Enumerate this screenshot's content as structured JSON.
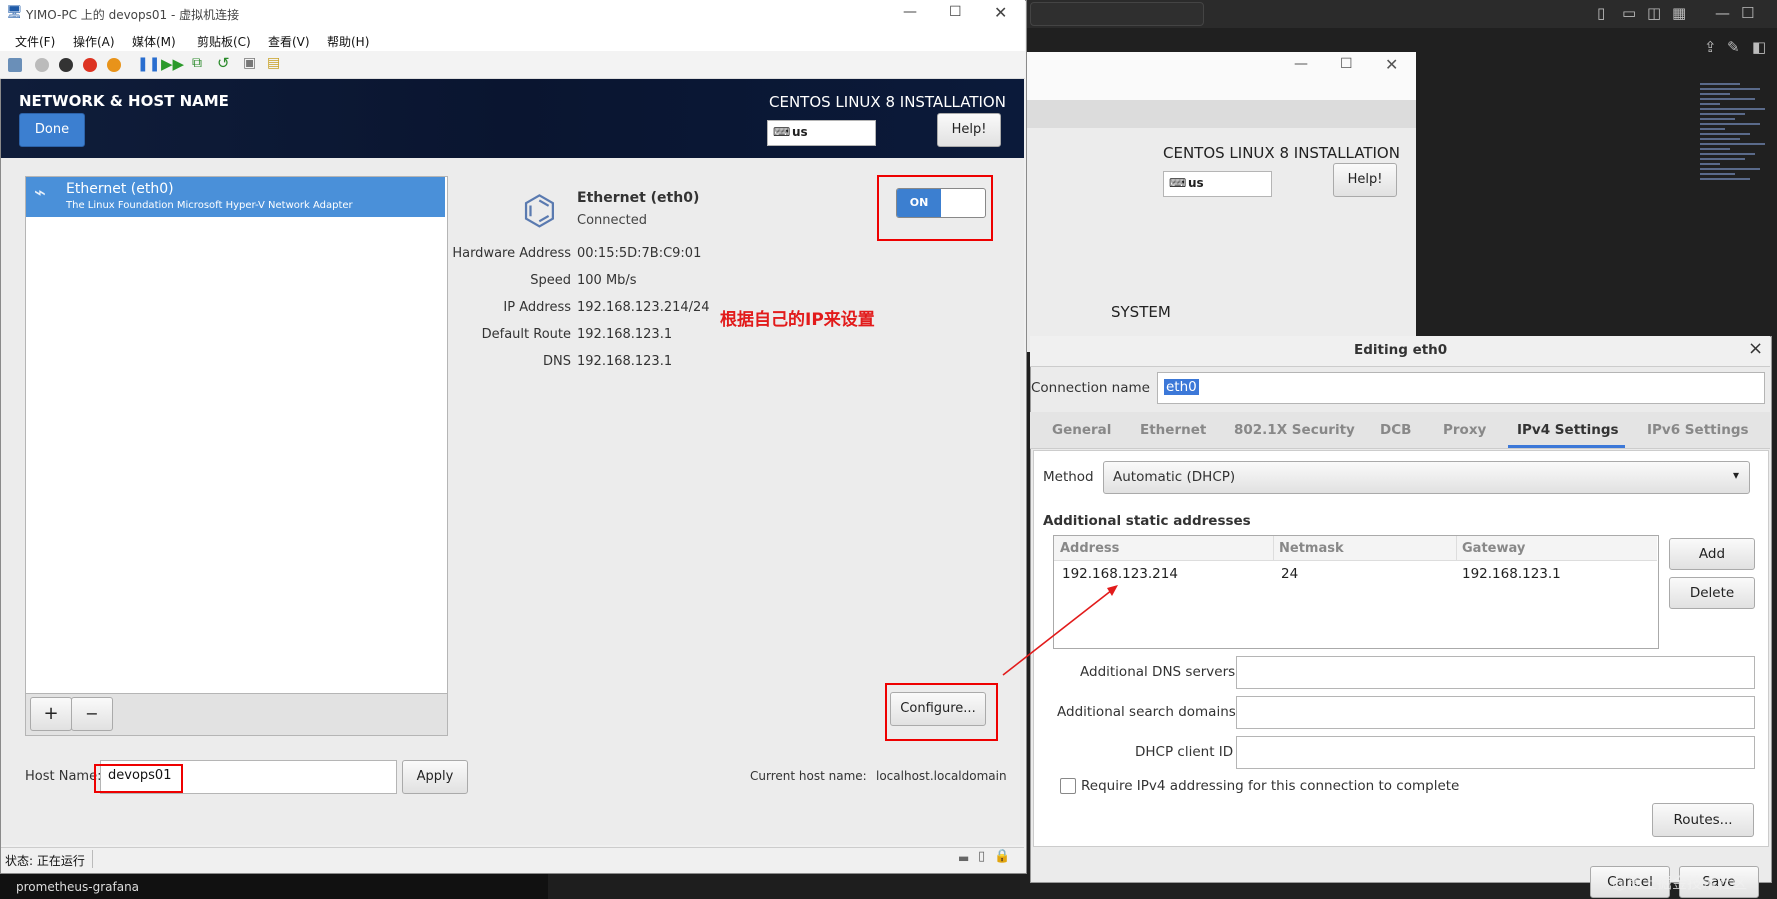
{
  "background": {
    "bottom_task_label": "prometheus-grafana",
    "mid_installer": {
      "title": "CENTOS LINUX 8 INSTALLATION",
      "keyboard": "us",
      "help": "Help!",
      "section": "SYSTEM"
    },
    "watermark": "@稀土掘金技术社区"
  },
  "vm_window": {
    "title": "YIMO-PC 上的 devops01 - 虚拟机连接",
    "menu": [
      "文件(F)",
      "操作(A)",
      "媒体(M)",
      "剪贴板(C)",
      "查看(V)",
      "帮助(H)"
    ],
    "status_label": "状态: 正在运行"
  },
  "installer": {
    "page_title": "NETWORK & HOST NAME",
    "done": "Done",
    "product": "CENTOS LINUX 8 INSTALLATION",
    "keyboard": "us",
    "help": "Help!",
    "device": {
      "name": "Ethernet (eth0)",
      "description": "The Linux Foundation Microsoft Hyper-V Network Adapter"
    },
    "detail": {
      "name": "Ethernet (eth0)",
      "status": "Connected",
      "toggle": "ON",
      "rows": [
        {
          "label": "Hardware Address",
          "value": "00:15:5D:7B:C9:01"
        },
        {
          "label": "Speed",
          "value": "100 Mb/s"
        },
        {
          "label": "IP Address",
          "value": "192.168.123.214/24"
        },
        {
          "label": "Default Route",
          "value": "192.168.123.1"
        },
        {
          "label": "DNS",
          "value": "192.168.123.1"
        }
      ],
      "configure": "Configure..."
    },
    "annotation": "根据自己的IP来设置",
    "add": "+",
    "remove": "−",
    "host_name_label": "Host Name:",
    "host_name_value": "devops01",
    "apply": "Apply",
    "current_host_label": "Current host name:",
    "current_host_value": "localhost.localdomain"
  },
  "dialog": {
    "title": "Editing eth0",
    "close": "×",
    "connection_name_label": "Connection name",
    "connection_name_value": "eth0",
    "tabs": [
      "General",
      "Ethernet",
      "802.1X Security",
      "DCB",
      "Proxy",
      "IPv4 Settings",
      "IPv6 Settings"
    ],
    "active_tab": "IPv4 Settings",
    "method_label": "Method",
    "method_value": "Automatic (DHCP)",
    "static_title": "Additional static addresses",
    "columns": [
      "Address",
      "Netmask",
      "Gateway"
    ],
    "rows": [
      [
        "192.168.123.214",
        "24",
        "192.168.123.1"
      ]
    ],
    "add": "Add",
    "delete": "Delete",
    "dns_label": "Additional DNS servers",
    "search_label": "Additional search domains",
    "dhcp_label": "DHCP client ID",
    "require_label": "Require IPv4 addressing for this connection to complete",
    "routes": "Routes...",
    "cancel": "Cancel",
    "save": "Save"
  }
}
